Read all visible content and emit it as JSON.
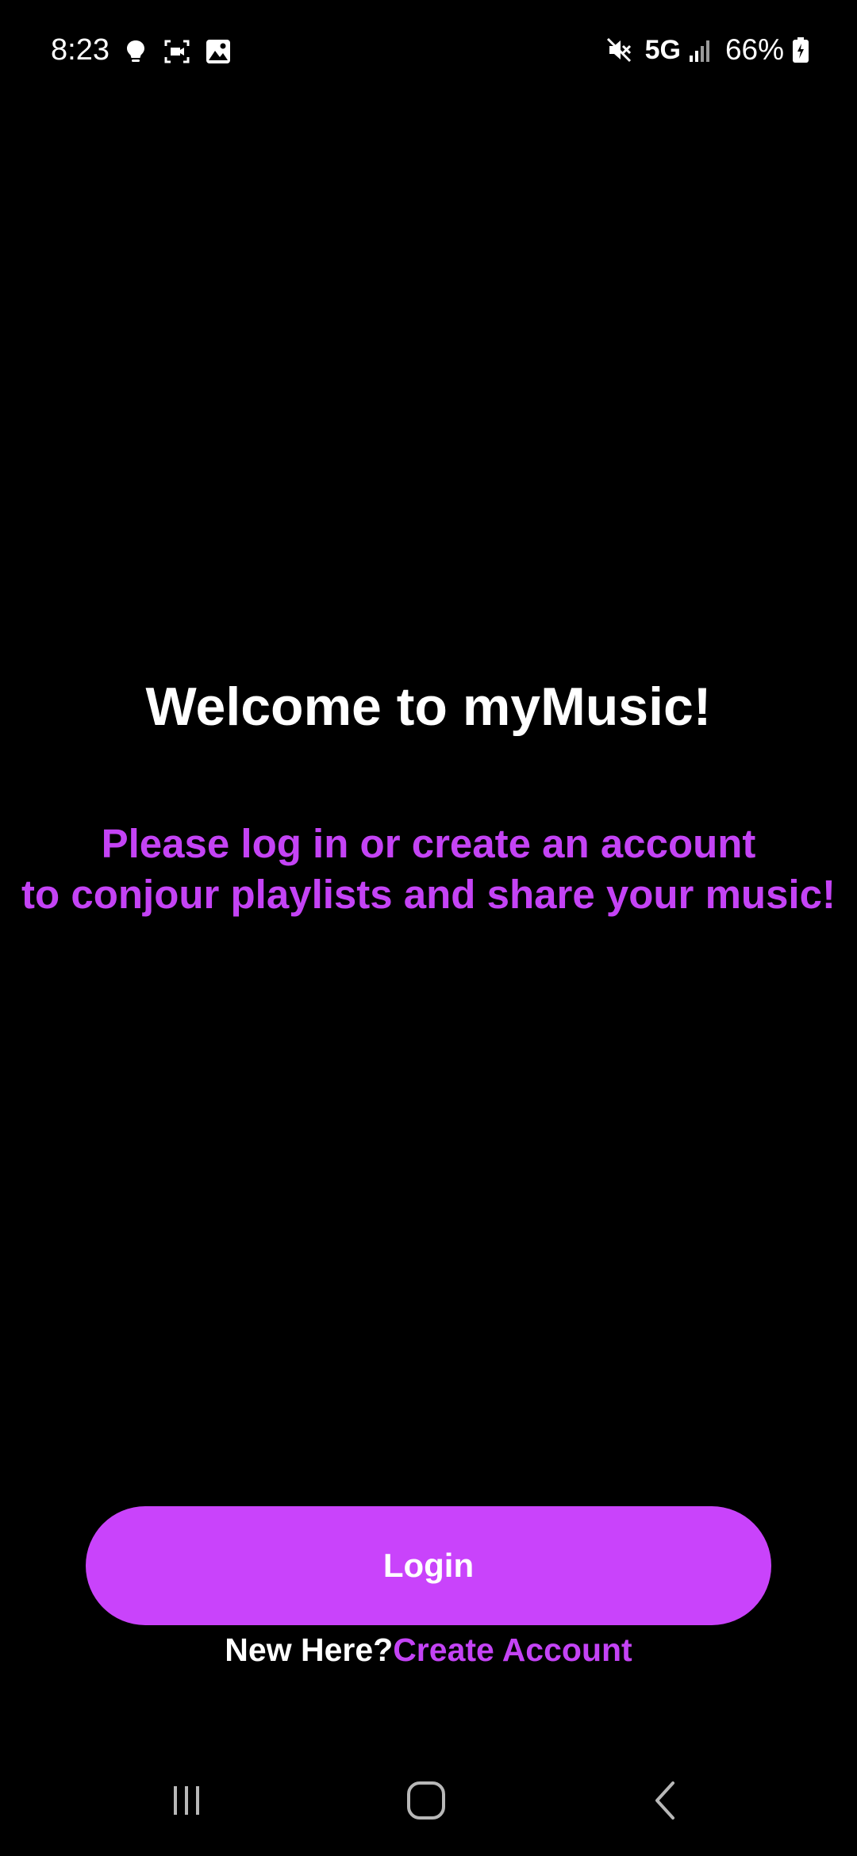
{
  "status_bar": {
    "time": "8:23",
    "left_icons": [
      "lightbulb-icon",
      "screen-recorder-icon",
      "gallery-icon"
    ],
    "right_icons": [
      "mute-icon",
      "signal-icon",
      "battery-icon"
    ],
    "network": "5G",
    "battery_percent": "66%"
  },
  "welcome": {
    "title": "Welcome to myMusic!",
    "subtitle_line1": "Please log in or create an account",
    "subtitle_line2": "to conjour playlists and share your music!"
  },
  "auth": {
    "login_label": "Login",
    "new_here_label": "New Here?",
    "create_account_label": "Create Account"
  },
  "nav_bar": {
    "buttons": [
      "recent-apps-icon",
      "home-icon",
      "back-icon"
    ]
  },
  "colors": {
    "background": "#000000",
    "accent": "#c943fb",
    "accent_text": "#c443f5",
    "text": "#ffffff"
  }
}
